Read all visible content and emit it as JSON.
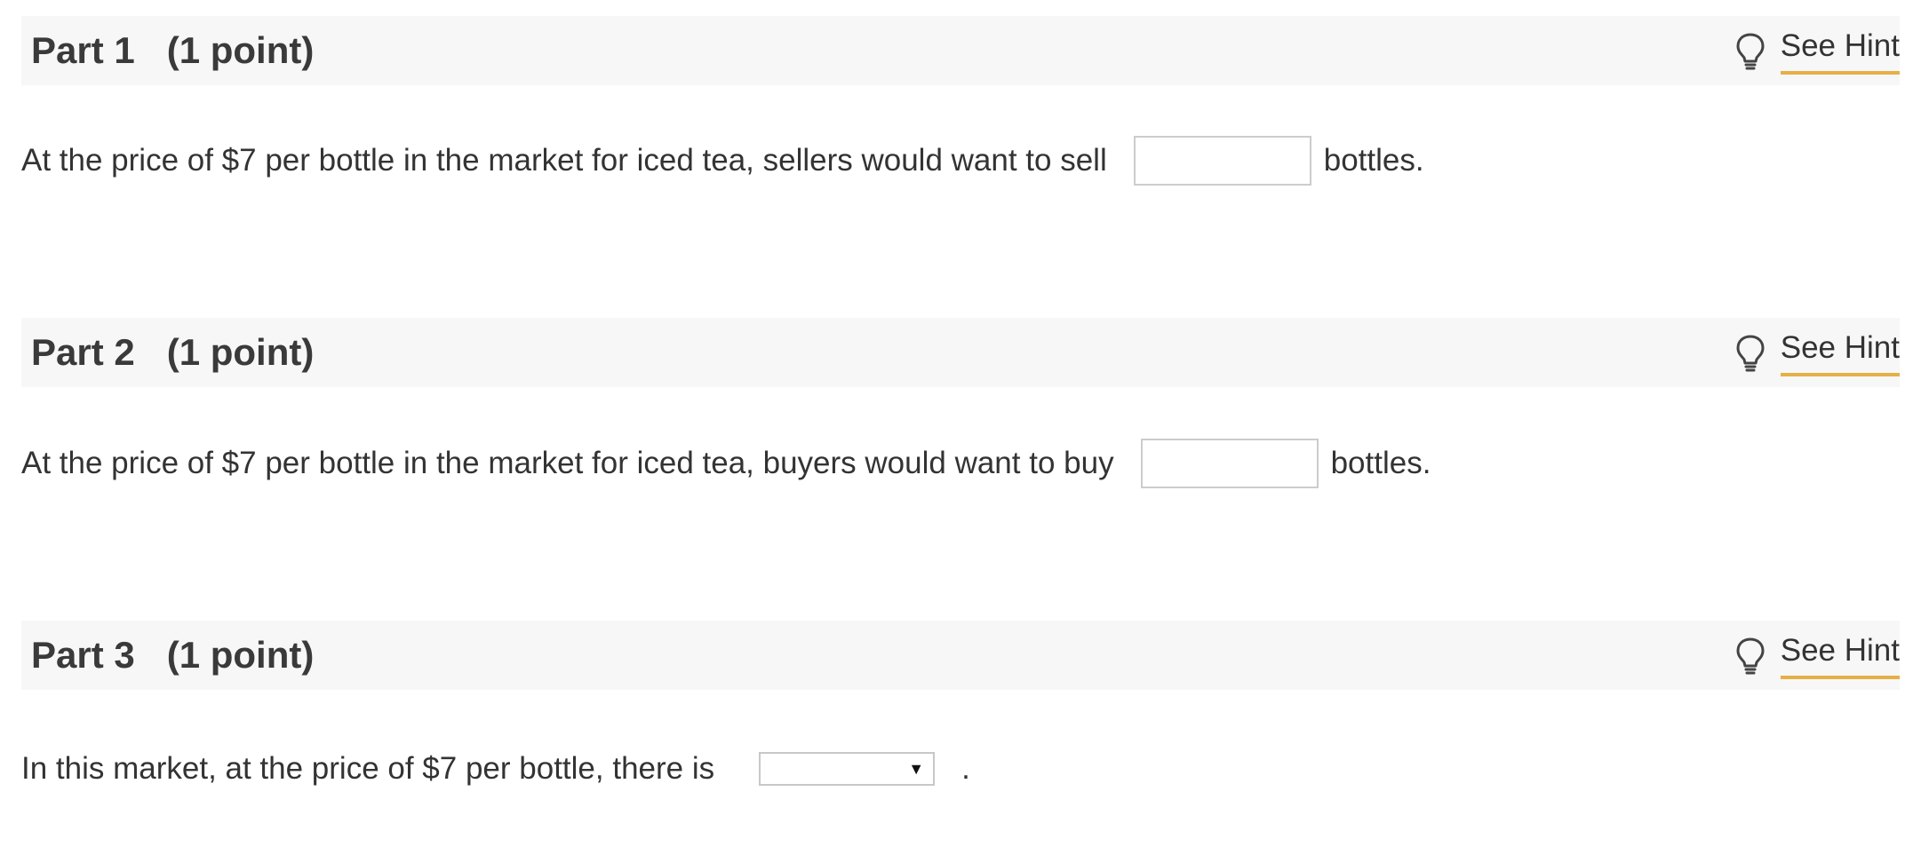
{
  "parts": [
    {
      "part_label": "Part 1",
      "points_label": "(1 point)",
      "hint_label": "See Hint",
      "question_text": "At the price of $7 per bottle in the market for iced tea, sellers would want to sell",
      "answer_value": "",
      "unit_text": "bottles."
    },
    {
      "part_label": "Part 2",
      "points_label": "(1 point)",
      "hint_label": "See Hint",
      "question_text": "At the price of $7 per bottle in the market for iced tea, buyers would want to buy",
      "answer_value": "",
      "unit_text": "bottles."
    },
    {
      "part_label": "Part 3",
      "points_label": "(1 point)",
      "hint_label": "See Hint",
      "question_text": "In this market, at the price of $7 per bottle, there is",
      "selected_option": "",
      "end_text": "."
    }
  ],
  "icons": {
    "hint": "lightbulb-icon"
  },
  "colors": {
    "header_background": "#f7f7f7",
    "hint_underline": "#e5b045",
    "text": "#333333",
    "input_border": "#cccccc"
  }
}
